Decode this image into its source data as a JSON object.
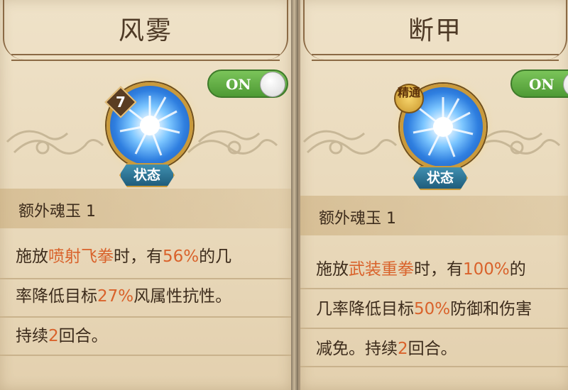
{
  "left_card": {
    "title": "风雾",
    "toggle_label": "ON",
    "level_badge": "7",
    "state_label": "状态",
    "subtitle": "额外魂玉 1",
    "desc": {
      "l1_a": "施放",
      "l1_b": "喷射飞拳",
      "l1_c": "时，有",
      "l1_d": "56%",
      "l1_e": "的几",
      "l2_a": "率降低目标",
      "l2_b": "27%",
      "l2_c": "风属性抗性。",
      "l3_a": "持续",
      "l3_b": "2",
      "l3_c": "回合。"
    }
  },
  "right_card": {
    "title": "断甲",
    "toggle_label": "ON",
    "mastery_badge": "精通",
    "state_label": "状态",
    "subtitle": "额外魂玉 1",
    "desc": {
      "l1_a": "施放",
      "l1_b": "武装重拳",
      "l1_c": "时，有",
      "l1_d": "100%",
      "l1_e": "的",
      "l2_a": "几率降低目标",
      "l2_b": "50%",
      "l2_c": "防御和伤害",
      "l3_a": "减免。持续",
      "l3_b": "2",
      "l3_c": "回合。"
    }
  },
  "colors": {
    "highlight": "#d9622b",
    "toggle_on": "#5aa83c",
    "text": "#3d2c1c"
  }
}
